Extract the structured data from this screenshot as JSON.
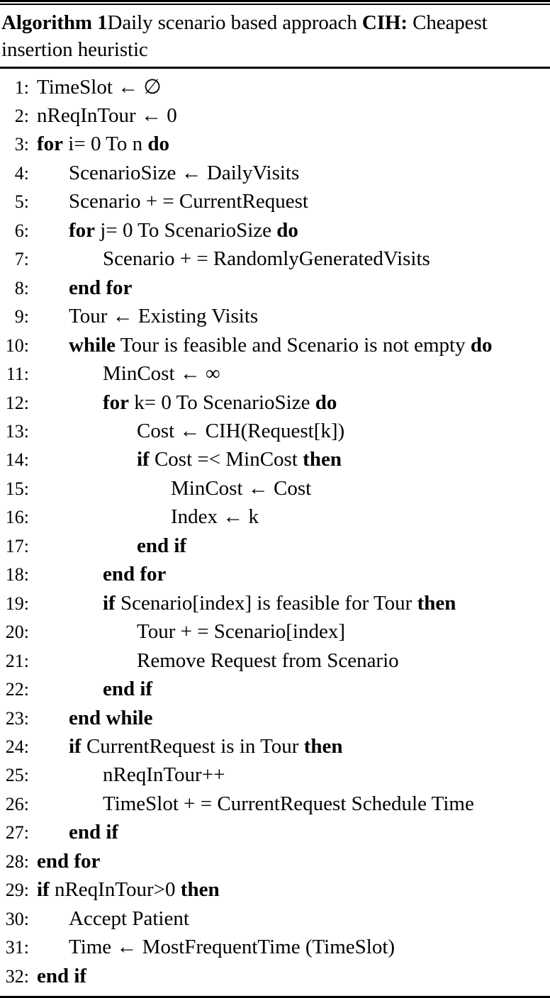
{
  "algorithm": {
    "caption": {
      "label": "Algorithm 1",
      "title_part1": "Daily scenario based approach ",
      "title_keyword": "CIH:",
      "title_part2": " Cheapest insertion heuristic",
      "full_text": "Algorithm 1 Daily scenario based approach CIH: Cheapest insertion heuristic"
    },
    "lines": [
      {
        "no": "1:",
        "indent": 0,
        "text": "TimeSlot ← ∅",
        "segments": [
          {
            "t": "TimeSlot ← ∅",
            "b": false
          }
        ]
      },
      {
        "no": "2:",
        "indent": 0,
        "text": "nReqInTour ← 0",
        "segments": [
          {
            "t": "nReqInTour ← 0",
            "b": false
          }
        ]
      },
      {
        "no": "3:",
        "indent": 0,
        "text": "for i= 0 To n do",
        "segments": [
          {
            "t": "for",
            "b": true
          },
          {
            "t": " i= 0 To n ",
            "b": false
          },
          {
            "t": "do",
            "b": true
          }
        ]
      },
      {
        "no": "4:",
        "indent": 1,
        "text": "ScenarioSize ← DailyVisits",
        "segments": [
          {
            "t": "ScenarioSize ← DailyVisits",
            "b": false
          }
        ]
      },
      {
        "no": "5:",
        "indent": 1,
        "text": "Scenario + = CurrentRequest",
        "segments": [
          {
            "t": "Scenario + = CurrentRequest",
            "b": false
          }
        ]
      },
      {
        "no": "6:",
        "indent": 1,
        "text": "for j= 0 To ScenarioSize do",
        "segments": [
          {
            "t": "for",
            "b": true
          },
          {
            "t": " j= 0 To ScenarioSize ",
            "b": false
          },
          {
            "t": "do",
            "b": true
          }
        ]
      },
      {
        "no": "7:",
        "indent": 2,
        "text": "Scenario + = RandomlyGeneratedVisits",
        "segments": [
          {
            "t": "Scenario + = RandomlyGeneratedVisits",
            "b": false
          }
        ]
      },
      {
        "no": "8:",
        "indent": 1,
        "text": "end for",
        "segments": [
          {
            "t": "end for",
            "b": true
          }
        ]
      },
      {
        "no": "9:",
        "indent": 1,
        "text": "Tour ← Existing Visits",
        "segments": [
          {
            "t": "Tour ← Existing Visits",
            "b": false
          }
        ]
      },
      {
        "no": "10:",
        "indent": 1,
        "text": "while Tour is feasible and Scenario is not empty do",
        "segments": [
          {
            "t": "while",
            "b": true
          },
          {
            "t": " Tour is feasible and Scenario is not empty ",
            "b": false
          },
          {
            "t": "do",
            "b": true
          }
        ]
      },
      {
        "no": "11:",
        "indent": 2,
        "text": "MinCost ← ∞",
        "segments": [
          {
            "t": "MinCost ← ∞",
            "b": false
          }
        ]
      },
      {
        "no": "12:",
        "indent": 2,
        "text": "for k= 0 To ScenarioSize do",
        "segments": [
          {
            "t": "for",
            "b": true
          },
          {
            "t": " k= 0 To ScenarioSize ",
            "b": false
          },
          {
            "t": "do",
            "b": true
          }
        ]
      },
      {
        "no": "13:",
        "indent": 3,
        "text": "Cost ← CIH(Request[k])",
        "segments": [
          {
            "t": "Cost ← CIH(Request[k])",
            "b": false
          }
        ]
      },
      {
        "no": "14:",
        "indent": 3,
        "text": "if Cost =< MinCost then",
        "segments": [
          {
            "t": "if",
            "b": true
          },
          {
            "t": " Cost =< MinCost ",
            "b": false
          },
          {
            "t": "then",
            "b": true
          }
        ]
      },
      {
        "no": "15:",
        "indent": 4,
        "text": "MinCost ← Cost",
        "segments": [
          {
            "t": "MinCost ← Cost",
            "b": false
          }
        ]
      },
      {
        "no": "16:",
        "indent": 4,
        "text": "Index ← k",
        "segments": [
          {
            "t": "Index ← k",
            "b": false
          }
        ]
      },
      {
        "no": "17:",
        "indent": 3,
        "text": "end if",
        "segments": [
          {
            "t": "end if",
            "b": true
          }
        ]
      },
      {
        "no": "18:",
        "indent": 2,
        "text": "end for",
        "segments": [
          {
            "t": "end for",
            "b": true
          }
        ]
      },
      {
        "no": "19:",
        "indent": 2,
        "text": "if Scenario[index] is feasible for Tour then",
        "segments": [
          {
            "t": "if",
            "b": true
          },
          {
            "t": " Scenario[index] is feasible for Tour ",
            "b": false
          },
          {
            "t": "then",
            "b": true
          }
        ]
      },
      {
        "no": "20:",
        "indent": 3,
        "text": "Tour + = Scenario[index]",
        "segments": [
          {
            "t": "Tour + = Scenario[index]",
            "b": false
          }
        ]
      },
      {
        "no": "21:",
        "indent": 3,
        "text": "Remove Request from Scenario",
        "segments": [
          {
            "t": "Remove Request from Scenario",
            "b": false
          }
        ]
      },
      {
        "no": "22:",
        "indent": 2,
        "text": "end if",
        "segments": [
          {
            "t": "end if",
            "b": true
          }
        ]
      },
      {
        "no": "23:",
        "indent": 1,
        "text": "end while",
        "segments": [
          {
            "t": "end while",
            "b": true
          }
        ]
      },
      {
        "no": "24:",
        "indent": 1,
        "text": "if CurrentRequest is in Tour then",
        "segments": [
          {
            "t": "if",
            "b": true
          },
          {
            "t": " CurrentRequest is in Tour ",
            "b": false
          },
          {
            "t": "then",
            "b": true
          }
        ]
      },
      {
        "no": "25:",
        "indent": 2,
        "text": "nReqInTour++",
        "segments": [
          {
            "t": "nReqInTour++",
            "b": false
          }
        ]
      },
      {
        "no": "26:",
        "indent": 2,
        "text": "TimeSlot + = CurrentRequest Schedule Time",
        "segments": [
          {
            "t": "TimeSlot + = CurrentRequest Schedule Time",
            "b": false
          }
        ]
      },
      {
        "no": "27:",
        "indent": 1,
        "text": "end if",
        "segments": [
          {
            "t": "end if",
            "b": true
          }
        ]
      },
      {
        "no": "28:",
        "indent": 0,
        "text": "end for",
        "segments": [
          {
            "t": "end for",
            "b": true
          }
        ]
      },
      {
        "no": "29:",
        "indent": 0,
        "text": "if  nReqInTour>0 then",
        "segments": [
          {
            "t": "if",
            "b": true
          },
          {
            "t": "  nReqInTour>0 ",
            "b": false
          },
          {
            "t": "then",
            "b": true
          }
        ]
      },
      {
        "no": "30:",
        "indent": 1,
        "text": "Accept Patient",
        "segments": [
          {
            "t": "Accept Patient",
            "b": false
          }
        ]
      },
      {
        "no": "31:",
        "indent": 1,
        "text": "Time ← MostFrequentTime (TimeSlot)",
        "segments": [
          {
            "t": "Time ← MostFrequentTime (TimeSlot)",
            "b": false
          }
        ]
      },
      {
        "no": "32:",
        "indent": 0,
        "text": "end if",
        "segments": [
          {
            "t": "end if",
            "b": true
          }
        ]
      }
    ]
  }
}
